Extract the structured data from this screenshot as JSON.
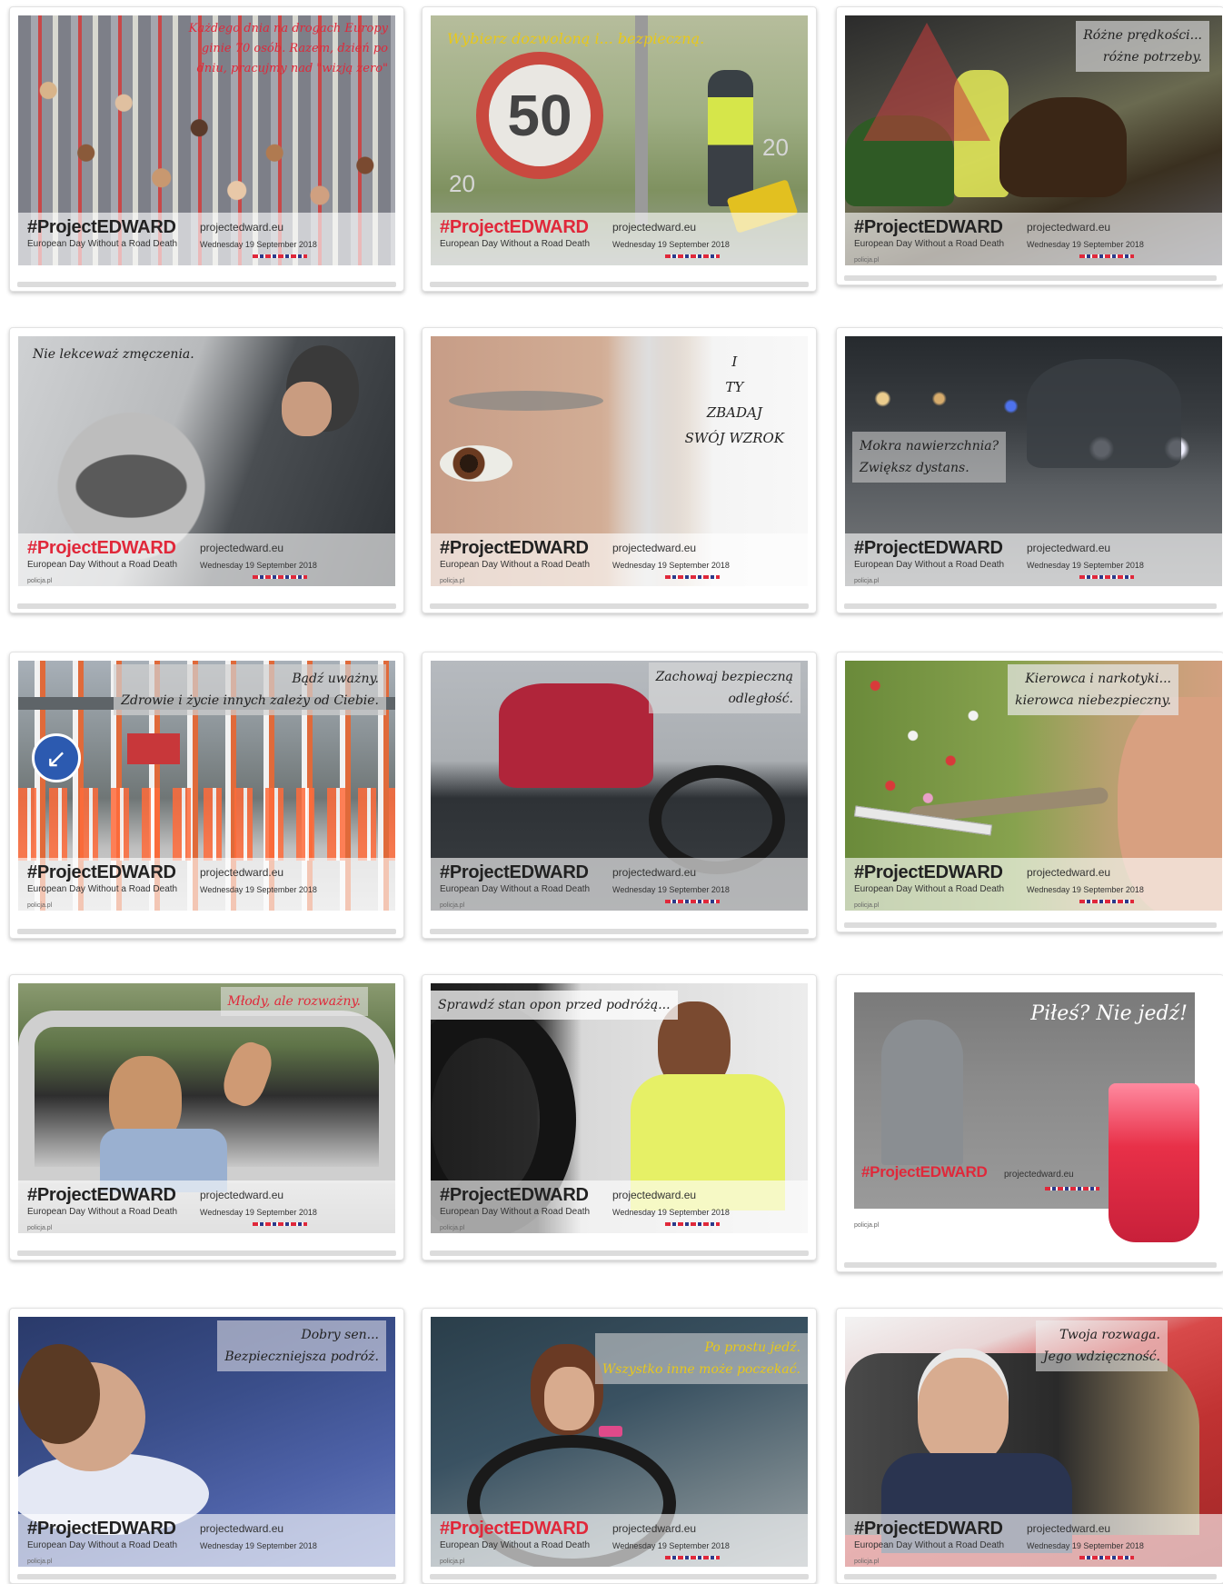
{
  "brand": {
    "hashtag": "#ProjectEDWARD",
    "subtitle": "European Day Without a Road Death",
    "site": "projectedward.eu",
    "date": "Wednesday 19 September 2018",
    "credit": "policja.pl"
  },
  "cards": [
    {
      "caption": "Każdego dnia na drogach Europy\nginie 70 osób. Razem, dzień po\ndniu, pracujmy nad \"wizją zero\"",
      "caption_color": "red"
    },
    {
      "caption": "Wybierz dozwoloną i... bezpieczną.",
      "caption_color": "yellow",
      "sign_value": "50",
      "gauge_left": "20",
      "gauge_right": "20"
    },
    {
      "caption": "Różne prędkości...\nróżne potrzeby.",
      "caption_color": "dark"
    },
    {
      "caption": "Nie lekceważ zmęczenia.",
      "caption_color": "dark"
    },
    {
      "caption": "I\nTY\nZBADAJ\nSWÓJ WZROK",
      "caption_color": "dark"
    },
    {
      "caption": "Mokra nawierzchnia?\nZwiększ dystans.",
      "caption_color": "dark"
    },
    {
      "caption": "Bądź uważny.\nZdrowie i życie innych zależy od Ciebie.",
      "caption_color": "dark"
    },
    {
      "caption": "Zachowaj bezpieczną\nodległość.",
      "caption_color": "dark"
    },
    {
      "caption": "Kierowca i narkotyki...\nkierowca niebezpieczny.",
      "caption_color": "dark"
    },
    {
      "caption": "Młody, ale rozważny.",
      "caption_color": "red"
    },
    {
      "caption": "Sprawdź stan opon przed podróżą...",
      "caption_color": "dark"
    },
    {
      "caption": "Piłeś? Nie jedź!",
      "caption_color": "white"
    },
    {
      "caption": "Dobry sen...\nBezpieczniejsza podróż.",
      "caption_color": "dark"
    },
    {
      "caption": "Po prostu jedź.\nWszystko inne może poczekać.",
      "caption_color": "yellow"
    },
    {
      "caption": "Twoja rozwaga.\nJego wdzięczność.",
      "caption_color": "dark"
    }
  ]
}
